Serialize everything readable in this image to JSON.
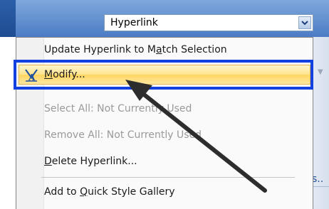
{
  "combo": {
    "value": "Hyperlink"
  },
  "menu": {
    "items": [
      {
        "label_pre": "Update Hyperlink to M",
        "accel": "a",
        "label_post": "tch Selection",
        "enabled": true
      },
      {
        "label_pre": "",
        "accel": "M",
        "label_post": "odify...",
        "enabled": true,
        "selected": true
      },
      {
        "label": "Select All: Not Currently Used",
        "enabled": false
      },
      {
        "label": "Remove All: Not Currently Used",
        "enabled": false
      },
      {
        "label_pre": "",
        "accel": "D",
        "label_post": "elete Hyperlink...",
        "enabled": true
      },
      {
        "label_pre": "Add to ",
        "accel": "Q",
        "label_post": "uick Style Gallery",
        "enabled": true
      }
    ]
  },
  "background": {
    "ellipsis": "s.."
  },
  "colors": {
    "highlight_frame": "#1340e0",
    "selected_fill": "#ffe38c",
    "disabled_text": "#9a9a9a",
    "arrow": "#2d2d2d"
  }
}
